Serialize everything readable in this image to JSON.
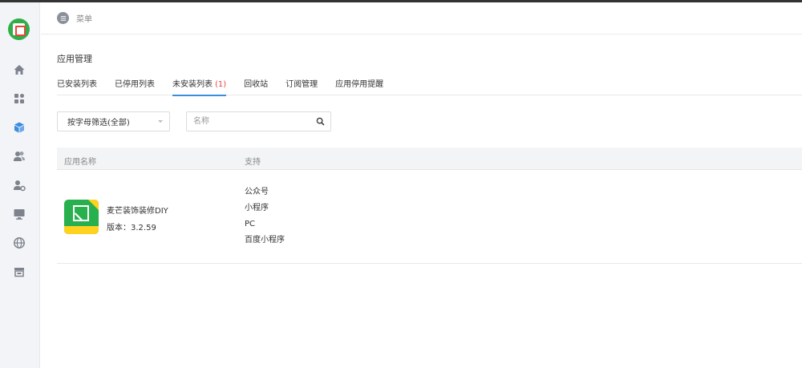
{
  "header": {
    "menu_label": "菜单"
  },
  "sidebar": {
    "items": [
      {
        "icon": "home-icon"
      },
      {
        "icon": "apps-grid-icon"
      },
      {
        "icon": "app-store-icon",
        "active": true
      },
      {
        "icon": "users-icon"
      },
      {
        "icon": "user-settings-icon"
      },
      {
        "icon": "monitor-icon"
      },
      {
        "icon": "globe-icon"
      },
      {
        "icon": "store-icon"
      }
    ]
  },
  "page": {
    "title": "应用管理",
    "tabs": [
      {
        "label": "已安装列表"
      },
      {
        "label": "已停用列表"
      },
      {
        "label": "未安装列表",
        "count": "(1)",
        "active": true
      },
      {
        "label": "回收站"
      },
      {
        "label": "订阅管理"
      },
      {
        "label": "应用停用提醒"
      }
    ]
  },
  "filters": {
    "letter_select": "按字母筛选(全部)",
    "search_placeholder": "名称"
  },
  "table": {
    "columns": [
      "应用名称",
      "支持"
    ],
    "rows": [
      {
        "name": "麦芒装饰装修DIY",
        "version": "版本：3.2.59",
        "support": [
          "公众号",
          "小程序",
          "PC",
          "百度小程序"
        ]
      }
    ]
  },
  "colors": {
    "accent": "#3c8dde",
    "count": "#e84545",
    "brand": "#2fae4a"
  }
}
